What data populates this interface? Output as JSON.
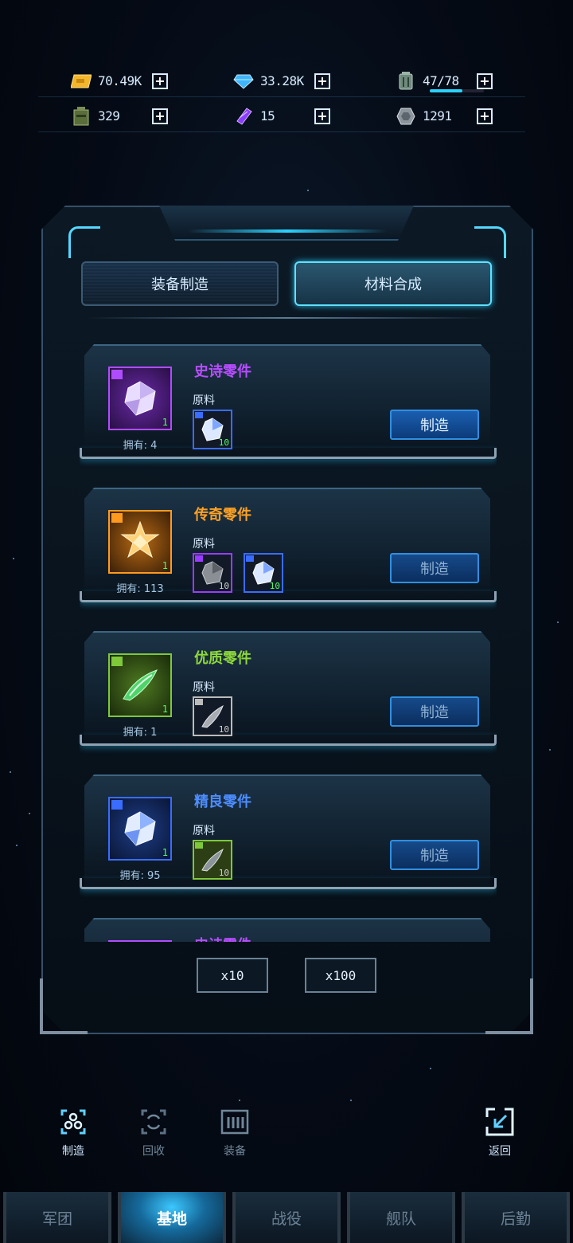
{
  "resources": [
    {
      "icon": "gold-ticket-icon",
      "value": "70.49K"
    },
    {
      "icon": "diamond-icon",
      "value": "33.28K"
    },
    {
      "icon": "energy-canister-icon",
      "value": "47/78",
      "fill": 0.6
    },
    {
      "icon": "supply-crate-icon",
      "value": "329"
    },
    {
      "icon": "purple-crystal-icon",
      "value": "15"
    },
    {
      "icon": "metal-plate-icon",
      "value": "1291"
    }
  ],
  "tabs": {
    "equip_craft": "装备制造",
    "material_synth": "材料合成"
  },
  "cards": [
    {
      "title": "史诗零件",
      "title_color": "#b84dff",
      "rarity_color": "#b04cff",
      "owned": "拥有: 4",
      "count": "1",
      "raw_label": "原料",
      "materials": [
        {
          "count": "10",
          "color": "#3a6cff",
          "count_color": "#4dff6a"
        }
      ],
      "make": "制造"
    },
    {
      "title": "传奇零件",
      "title_color": "#ffa223",
      "rarity_color": "#ff9a1f",
      "owned": "拥有: 113",
      "count": "1",
      "raw_label": "原料",
      "materials": [
        {
          "count": "10",
          "color": "#9a3cff",
          "count_color": "#d0d0d0"
        },
        {
          "count": "10",
          "color": "#3a6cff",
          "count_color": "#4dff6a"
        }
      ],
      "make": "制造"
    },
    {
      "title": "优质零件",
      "title_color": "#8ed83a",
      "rarity_color": "#7ec83a",
      "owned": "拥有: 1",
      "count": "1",
      "raw_label": "原料",
      "materials": [
        {
          "count": "10",
          "color": "#bbbbbb",
          "count_color": "#d0d0d0"
        }
      ],
      "make": "制造"
    },
    {
      "title": "精良零件",
      "title_color": "#4d8dff",
      "rarity_color": "#3a6cff",
      "owned": "拥有: 95",
      "count": "1",
      "raw_label": "原料",
      "materials": [
        {
          "count": "10",
          "color": "#7ec83a",
          "count_color": "#d0d0d0"
        }
      ],
      "make": "制造"
    },
    {
      "title": "史诗零件",
      "title_color": "#b84dff",
      "rarity_color": "#b04cff",
      "owned": "",
      "count": "",
      "raw_label": "",
      "materials": [],
      "make": ""
    }
  ],
  "multipliers": {
    "x10": "x10",
    "x100": "x100"
  },
  "actions": {
    "craft": "制造",
    "recycle": "回收",
    "equip": "装备",
    "back": "返回"
  },
  "nav": [
    "军团",
    "基地",
    "战役",
    "舰队",
    "后勤"
  ],
  "nav_active": 1
}
